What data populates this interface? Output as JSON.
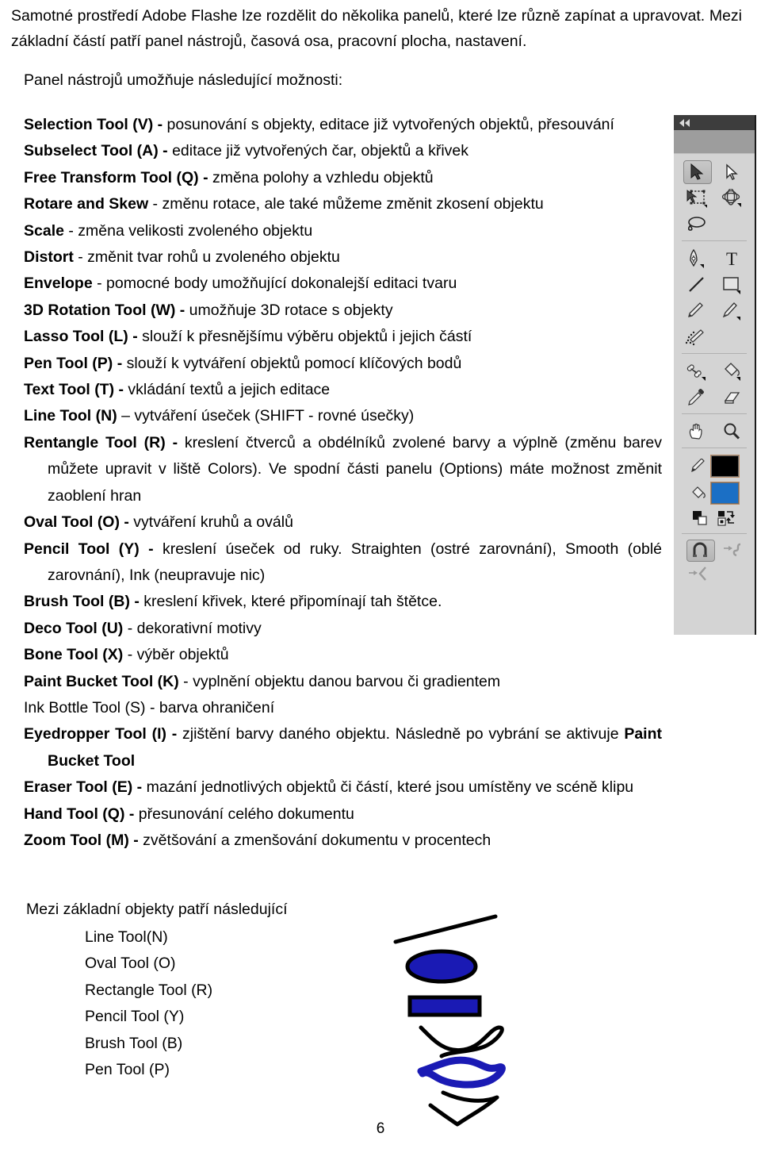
{
  "document": {
    "intro": "Samotné prostředí Adobe Flashe lze rozdělit do několika panelů, které lze různě zapínat a upravovat. Mezi základní částí patří panel nástrojů, časová osa, pracovní plocha, nastavení.",
    "lead": "Panel nástrojů umožňuje následující možnosti:",
    "page_number": "6"
  },
  "tools": [
    {
      "name": "Selection Tool (V) -",
      "bold": true,
      "desc": " posunování s objekty, editace již vytvořených objektů, přesouvání",
      "justify": true
    },
    {
      "name": "Subselect Tool (A) -",
      "bold": true,
      "desc": " editace již vytvořených čar, objektů a křivek",
      "justify": false
    },
    {
      "name": "Free Transform Tool (Q) -",
      "bold": true,
      "desc": " změna polohy a vzhledu objektů",
      "justify": false
    },
    {
      "name": "Rotare and Skew",
      "bold": true,
      "desc": " - změnu rotace, ale také můžeme změnit zkosení objektu",
      "justify": false
    },
    {
      "name": "Scale",
      "bold": true,
      "desc": " - změna velikosti zvoleného objektu",
      "justify": false
    },
    {
      "name": "Distort",
      "bold": true,
      "desc": " - změnit tvar rohů u zvoleného objektu",
      "justify": false
    },
    {
      "name": "Envelope",
      "bold": true,
      "desc": " - pomocné body umožňující dokonalejší editaci tvaru",
      "justify": false
    },
    {
      "name": "3D Rotation Tool (W) -",
      "bold": true,
      "desc": " umožňuje 3D rotace s objekty",
      "justify": false
    },
    {
      "name": "Lasso Tool (L) -",
      "bold": true,
      "desc": " slouží k přesnějšímu výběru objektů i jejich částí",
      "justify": false
    },
    {
      "name": "Pen Tool (P) -",
      "bold": true,
      "desc": " slouží k vytváření objektů pomocí klíčových bodů",
      "justify": false
    },
    {
      "name": "Text Tool (T) -",
      "bold": true,
      "desc": " vkládání textů a jejich editace",
      "justify": false
    },
    {
      "name": "Line Tool (N)",
      "bold": true,
      "desc": " – vytváření úseček (SHIFT - rovné úsečky)",
      "justify": false
    },
    {
      "name": "Rentangle Tool (R) -",
      "bold": true,
      "desc": " kreslení čtverců a obdélníků zvolené barvy a výplně (změnu barev můžete upravit v liště Colors). Ve spodní části panelu (Options) máte možnost změnit zaoblení hran",
      "justify": true
    },
    {
      "name": "Oval Tool (O) -",
      "bold": true,
      "desc": " vytváření kruhů a oválů",
      "justify": false
    },
    {
      "name": "Pencil Tool (Y) -",
      "bold": true,
      "desc": " kreslení úseček od ruky. Straighten (ostré zarovnání), Smooth (oblé zarovnání), Ink (neupravuje nic)",
      "justify": true
    },
    {
      "name": "Brush Tool (B) -",
      "bold": true,
      "desc": " kreslení křivek, které připomínají tah štětce.",
      "justify": false
    },
    {
      "name": "Deco Tool (U)",
      "bold": true,
      "desc": " - dekorativní motivy",
      "justify": false
    },
    {
      "name": "Bone Tool (X)",
      "bold": true,
      "desc": " - výběr objektů",
      "justify": false
    },
    {
      "name": "Paint Bucket Tool (K)",
      "bold": true,
      "desc": " - vyplnění objektu danou barvou či gradientem",
      "justify": false
    },
    {
      "name": "Ink Bottle Tool (S) - barva ohraničení",
      "bold": false,
      "desc": "",
      "justify": false
    },
    {
      "name": "Eyedropper Tool (I) -",
      "bold": true,
      "desc": "  zjištění barvy daného objektu. Následně po vybrání se aktivuje ",
      "desc_bold_tail": "Paint Bucket Tool",
      "justify": true
    },
    {
      "name": "Eraser Tool (E) -",
      "bold": true,
      "desc": " mazání jednotlivých objektů či částí, které jsou umístěny ve scéně klipu",
      "justify": false
    },
    {
      "name": "Hand Tool (Q) -",
      "bold": true,
      "desc": " přesunování celého dokumentu",
      "justify": false
    },
    {
      "name": "Zoom Tool (M) -",
      "bold": true,
      "desc": " zvětšování a zmenšování dokumentu v procentech",
      "justify": false
    }
  ],
  "objects_section": {
    "heading": "Mezi základní objekty patří následující",
    "items": [
      "Line Tool(N)",
      "Oval Tool (O)",
      "Rectangle Tool (R)",
      "Pencil Tool (Y)",
      "Brush Tool (B)",
      "Pen Tool (P)"
    ]
  },
  "sample_drawings": {
    "line_color": "#000000",
    "oval_fill": "#1a1ab4",
    "oval_stroke": "#000000",
    "rect_fill": "#1a1ab4",
    "rect_stroke": "#000000",
    "pencil_stroke": "#000000",
    "brush_stroke": "#1a1ab4",
    "pen_stroke": "#000000"
  },
  "flash_panel": {
    "title_icon": "collapse-double-arrow-icon",
    "stroke_color": "#000000",
    "fill_color": "#1b6fc5",
    "rows": [
      {
        "cells": [
          {
            "icon": "selection-arrow-tool-icon",
            "selected": true
          },
          {
            "icon": "subselection-arrow-tool-icon",
            "selected": false
          }
        ]
      },
      {
        "cells": [
          {
            "icon": "free-transform-tool-icon",
            "selected": false
          },
          {
            "icon": "3d-rotation-tool-icon",
            "selected": false
          }
        ]
      },
      {
        "cells": [
          {
            "icon": "lasso-tool-icon",
            "selected": false
          }
        ]
      },
      {
        "separator": true
      },
      {
        "cells": [
          {
            "icon": "pen-tool-icon",
            "selected": false
          },
          {
            "icon": "text-tool-icon",
            "selected": false
          }
        ]
      },
      {
        "cells": [
          {
            "icon": "line-tool-icon",
            "selected": false
          },
          {
            "icon": "rectangle-tool-icon",
            "selected": false
          }
        ]
      },
      {
        "cells": [
          {
            "icon": "pencil-tool-icon",
            "selected": false
          },
          {
            "icon": "brush-tool-icon",
            "selected": false
          }
        ]
      },
      {
        "cells": [
          {
            "icon": "spray-brush-tool-icon",
            "selected": false
          }
        ]
      },
      {
        "separator": true
      },
      {
        "cells": [
          {
            "icon": "bone-tool-icon",
            "selected": false
          },
          {
            "icon": "paint-bucket-tool-icon",
            "selected": false
          }
        ]
      },
      {
        "cells": [
          {
            "icon": "eyedropper-tool-icon",
            "selected": false
          },
          {
            "icon": "eraser-tool-icon",
            "selected": false
          }
        ]
      },
      {
        "separator": true
      },
      {
        "cells": [
          {
            "icon": "hand-tool-icon",
            "selected": false
          },
          {
            "icon": "zoom-tool-icon",
            "selected": false
          }
        ]
      },
      {
        "separator": true
      }
    ],
    "colors_section": {
      "stroke_label_icon": "pencil-stroke-color-icon",
      "fill_label_icon": "paint-bucket-fill-color-icon",
      "reset_icon": "black-white-colors-icon",
      "swap_icon": "swap-colors-icon"
    },
    "options_section": {
      "magnet_icon": "snap-to-objects-icon",
      "smooth_icon": "smooth-option-icon",
      "straighten_icon": "straighten-option-icon"
    }
  }
}
